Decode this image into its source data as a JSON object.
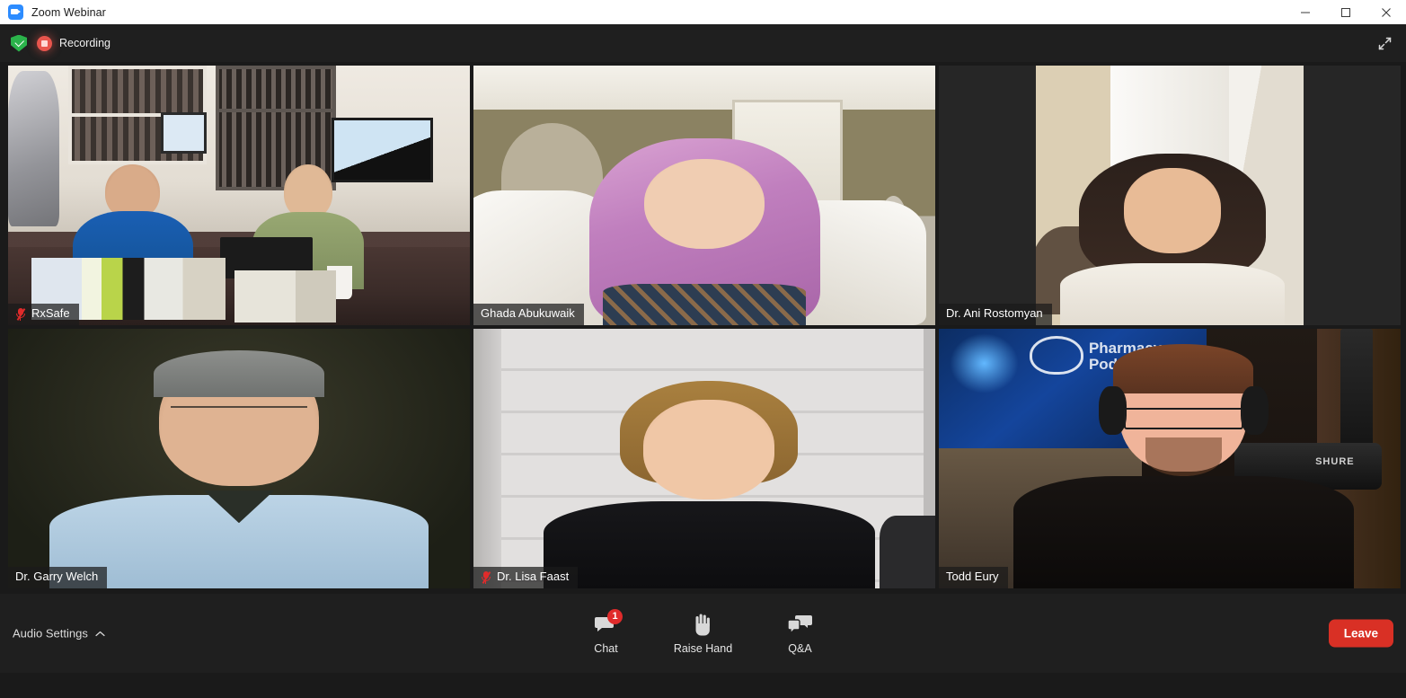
{
  "window": {
    "title": "Zoom Webinar",
    "logo_icon": "zoom-logo-icon",
    "controls": {
      "minimize": "minimize-icon",
      "maximize": "maximize-icon",
      "close": "close-icon"
    }
  },
  "topbar": {
    "encryption_icon": "green-shield-check-icon",
    "recording_icon": "recording-dot-icon",
    "recording_label": "Recording",
    "fullscreen_icon": "enter-full-screen-icon"
  },
  "participants": [
    {
      "name": "RxSafe",
      "muted": true,
      "active_speaker": false,
      "scene": "pharmacy-two-men",
      "pillarboxed": false
    },
    {
      "name": "Ghada Abukuwaik",
      "muted": false,
      "active_speaker": false,
      "scene": "bedroom-woman-pink-hijab",
      "pillarboxed": false
    },
    {
      "name": "Dr. Ani Rostomyan",
      "muted": false,
      "active_speaker": false,
      "scene": "curtain-woman-white-top",
      "pillarboxed": true
    },
    {
      "name": "Dr. Garry Welch",
      "muted": false,
      "active_speaker": true,
      "scene": "older-man-blue-shirt",
      "pillarboxed": false
    },
    {
      "name": "Dr. Lisa Faast",
      "muted": true,
      "active_speaker": false,
      "scene": "shiplap-woman-black-top",
      "pillarboxed": false
    },
    {
      "name": "Todd Eury",
      "muted": false,
      "active_speaker": false,
      "scene": "podcast-studio-man-headphones",
      "pillarboxed": false
    }
  ],
  "todd_scene_text": {
    "screen_logo_line1": "Pharmacy",
    "screen_logo_line2": "Podcast",
    "mic_brand": "SHURE"
  },
  "toolbar": {
    "audio_settings_label": "Audio Settings",
    "audio_settings_caret_icon": "chevron-up-icon",
    "controls": [
      {
        "label": "Chat",
        "icon": "chat-bubble-icon",
        "badge": "1"
      },
      {
        "label": "Raise Hand",
        "icon": "raise-hand-icon",
        "badge": ""
      },
      {
        "label": "Q&A",
        "icon": "qa-bubbles-icon",
        "badge": ""
      }
    ],
    "leave_label": "Leave"
  },
  "colors": {
    "accent_blue": "#2d8cff",
    "recording_red": "#e8554d",
    "leave_red": "#d93025",
    "active_speaker_border": "#d8e84c",
    "badge_red": "#e02b2b",
    "shield_green": "#2bb34b"
  }
}
